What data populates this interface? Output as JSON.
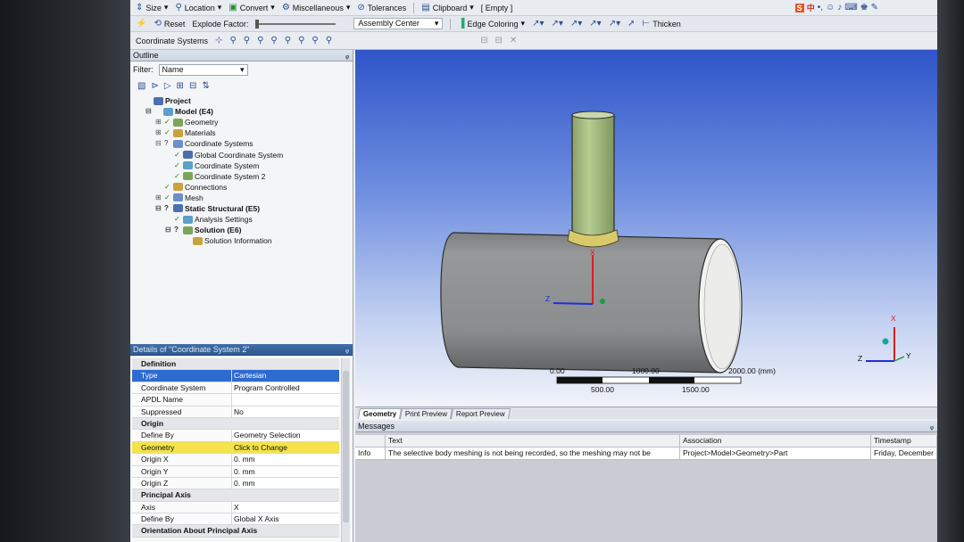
{
  "toolbar_row1": {
    "size": "Size",
    "location": "Location",
    "convert": "Convert",
    "miscellaneous": "Miscellaneous",
    "tolerances": "Tolerances",
    "clipboard": "Clipboard",
    "clipboard_state": "[ Empty ]",
    "ime_label": "中"
  },
  "toolbar_row2": {
    "reset": "Reset",
    "explode_factor": "Explode Factor:",
    "assembly_center": "Assembly Center",
    "edge_coloring": "Edge Coloring",
    "thicken": "Thicken"
  },
  "toolbar_row3": {
    "coordinate_systems": "Coordinate Systems"
  },
  "outline": {
    "title": "Outline",
    "pin": "ᵩ",
    "filter_label": "Filter:",
    "filter_value": "Name",
    "tree": [
      {
        "label": "Project",
        "level": 0,
        "bold": true,
        "expander": "",
        "status": ""
      },
      {
        "label": "Model (E4)",
        "level": 1,
        "bold": true,
        "expander": "⊟",
        "status": ""
      },
      {
        "label": "Geometry",
        "level": 2,
        "bold": false,
        "expander": "⊞",
        "status": "✓"
      },
      {
        "label": "Materials",
        "level": 2,
        "bold": false,
        "expander": "⊞",
        "status": "✓"
      },
      {
        "label": "Coordinate Systems",
        "level": 2,
        "bold": false,
        "expander": "⊟",
        "status": "?"
      },
      {
        "label": "Global Coordinate System",
        "level": 3,
        "bold": false,
        "expander": "",
        "status": "✓"
      },
      {
        "label": "Coordinate System",
        "level": 3,
        "bold": false,
        "expander": "",
        "status": "✓"
      },
      {
        "label": "Coordinate System 2",
        "level": 3,
        "bold": false,
        "expander": "",
        "status": "✓"
      },
      {
        "label": "Connections",
        "level": 2,
        "bold": false,
        "expander": "",
        "status": "✓"
      },
      {
        "label": "Mesh",
        "level": 2,
        "bold": false,
        "expander": "⊞",
        "status": "✓"
      },
      {
        "label": "Static Structural (E5)",
        "level": 2,
        "bold": true,
        "expander": "⊟",
        "status": "?"
      },
      {
        "label": "Analysis Settings",
        "level": 3,
        "bold": false,
        "expander": "",
        "status": "✓"
      },
      {
        "label": "Solution (E6)",
        "level": 3,
        "bold": true,
        "expander": "⊟",
        "status": "?"
      },
      {
        "label": "Solution Information",
        "level": 4,
        "bold": false,
        "expander": "",
        "status": ""
      }
    ]
  },
  "details": {
    "title": "Details of \"Coordinate System 2\"",
    "rows": [
      {
        "kind": "sec",
        "k": "Definition",
        "v": ""
      },
      {
        "kind": "sel",
        "k": "Type",
        "v": "Cartesian"
      },
      {
        "kind": "row",
        "k": "Coordinate System",
        "v": "Program Controlled"
      },
      {
        "kind": "row",
        "k": "APDL Name",
        "v": ""
      },
      {
        "kind": "row",
        "k": "Suppressed",
        "v": "No"
      },
      {
        "kind": "sec",
        "k": "Origin",
        "v": ""
      },
      {
        "kind": "row",
        "k": "Define By",
        "v": "Geometry Selection"
      },
      {
        "kind": "yel",
        "k": "Geometry",
        "v": "Click to Change"
      },
      {
        "kind": "row",
        "k": "Origin X",
        "v": "0. mm"
      },
      {
        "kind": "row",
        "k": "Origin Y",
        "v": "0. mm"
      },
      {
        "kind": "row",
        "k": "Origin Z",
        "v": "0. mm"
      },
      {
        "kind": "sec",
        "k": "Principal Axis",
        "v": ""
      },
      {
        "kind": "row",
        "k": "Axis",
        "v": "X"
      },
      {
        "kind": "row",
        "k": "Define By",
        "v": "Global X Axis"
      },
      {
        "kind": "sec",
        "k": "Orientation About Principal Axis",
        "v": ""
      }
    ]
  },
  "viewport": {
    "triad_x": "X",
    "triad_y": "Y",
    "triad_z": "Z",
    "scale": {
      "t0": "0.00",
      "t1": "1000.00",
      "t2": "2000.00 (mm)",
      "b1": "500.00",
      "b2": "1500.00"
    }
  },
  "tabs": [
    "Geometry",
    "Print Preview",
    "Report Preview"
  ],
  "messages": {
    "title": "Messages",
    "headers": [
      "",
      "Text",
      "Association",
      "Timestamp"
    ],
    "rows": [
      [
        "Info",
        "The selective body meshing is not being recorded, so the meshing may not be",
        "Project>Model>Geometry>Part",
        "Friday, December"
      ]
    ]
  },
  "colors": {
    "accent": "#2d6bd0",
    "highlight": "#f4e34a",
    "pipe": "#8e9091",
    "branch": "#a9bf86"
  }
}
